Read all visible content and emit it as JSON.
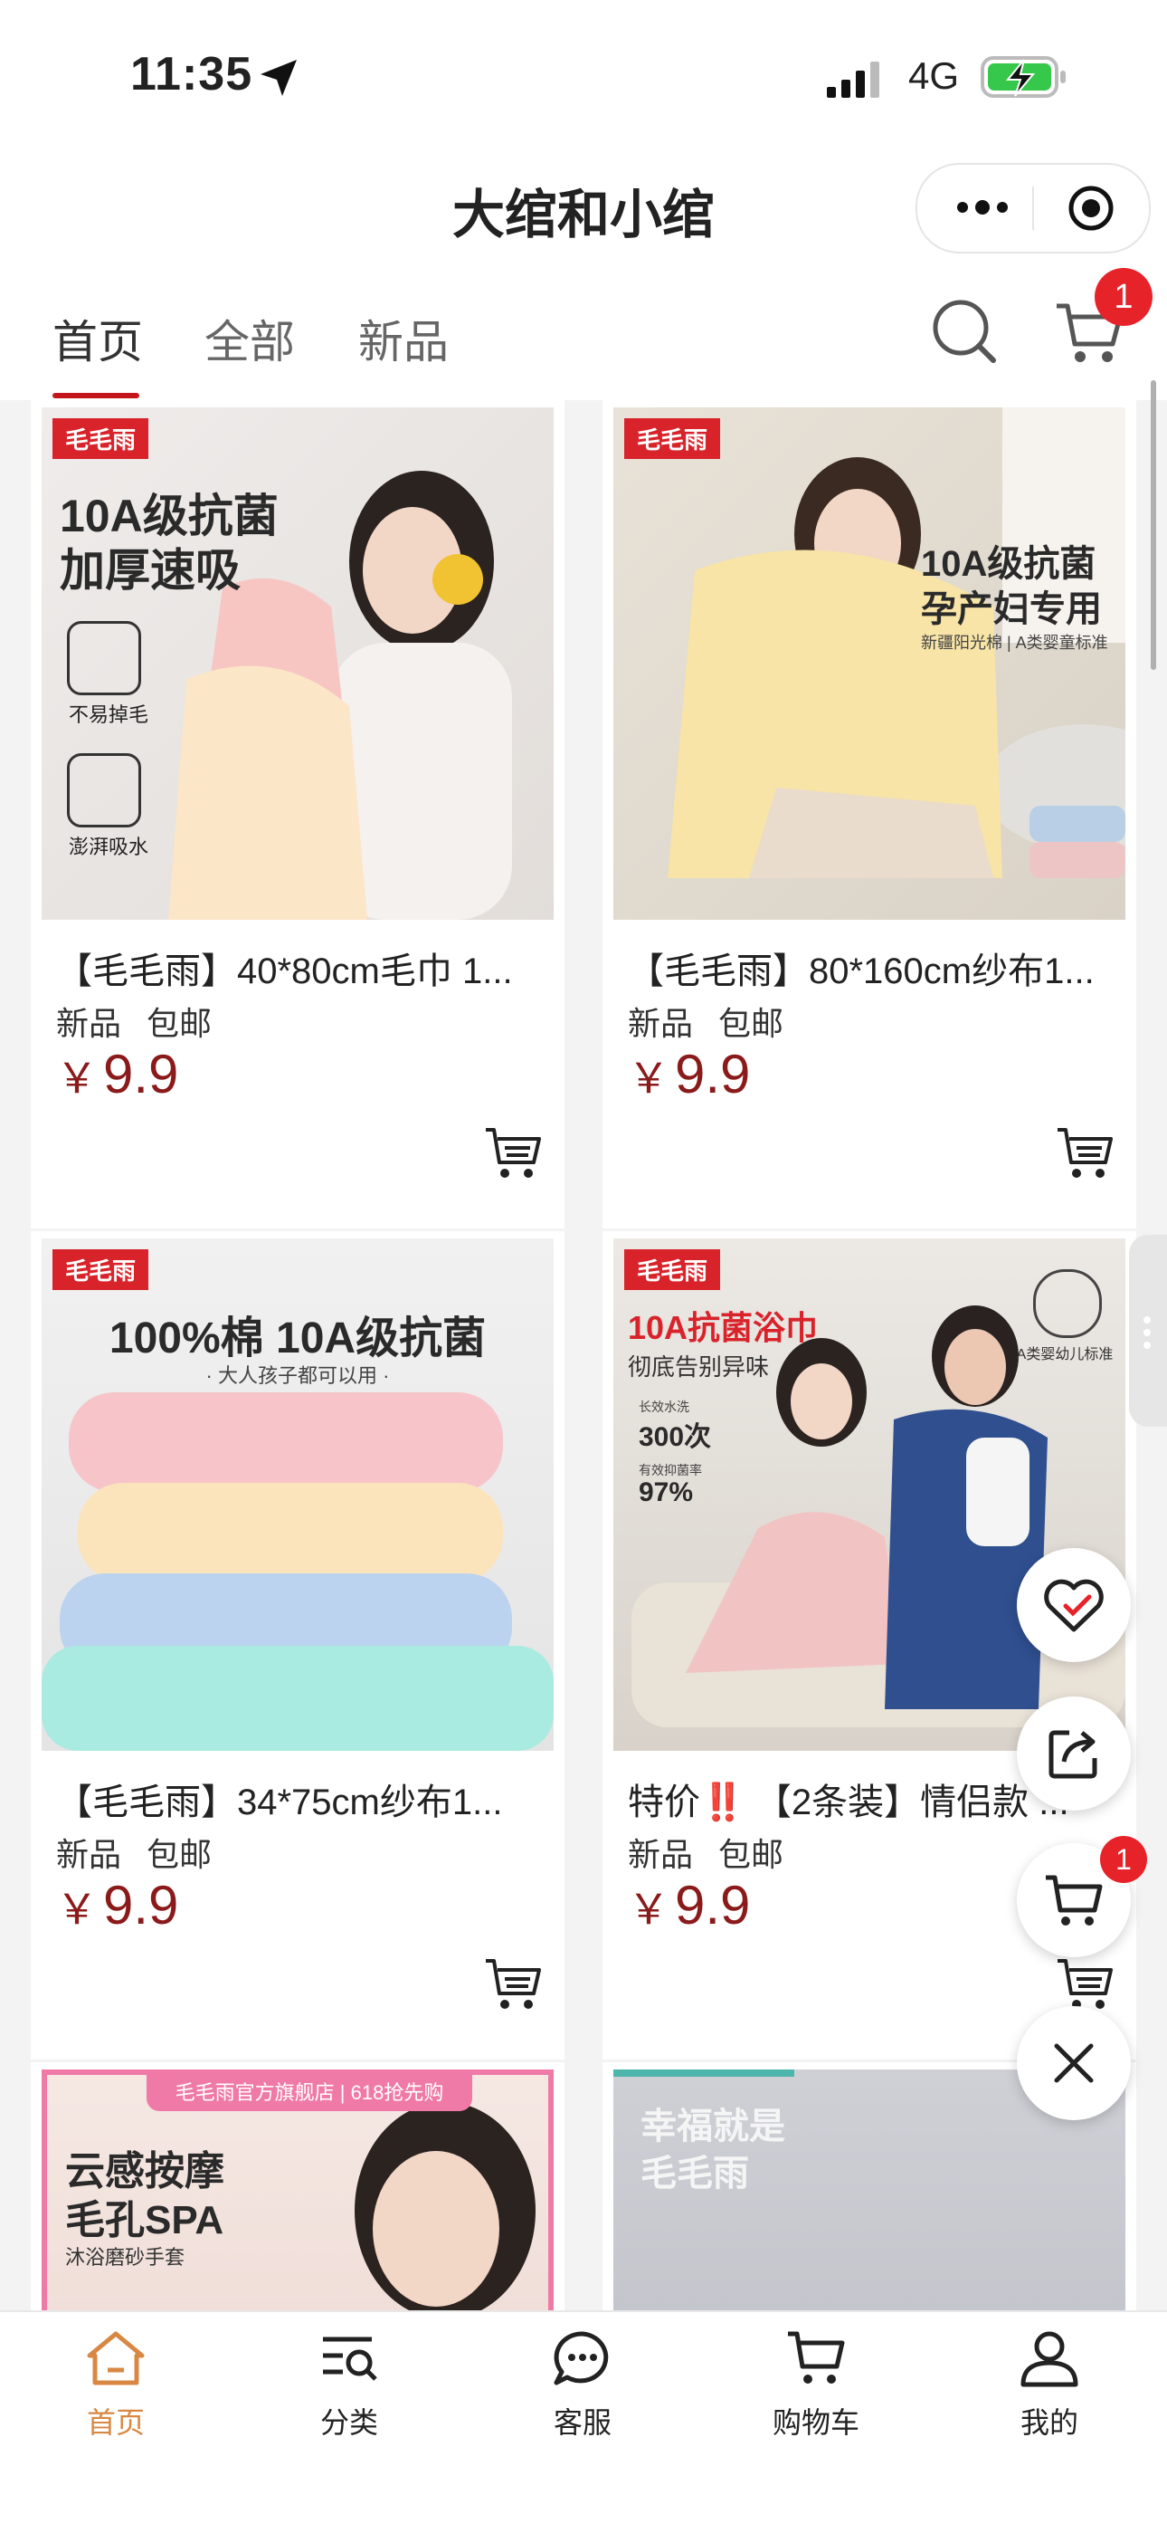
{
  "status_bar": {
    "time": "11:35",
    "network": "4G"
  },
  "title_bar": {
    "title": "大绾和小绾"
  },
  "tabs": [
    {
      "label": "首页",
      "active": true
    },
    {
      "label": "全部",
      "active": false
    },
    {
      "label": "新品",
      "active": false
    }
  ],
  "cart_count": "1",
  "products": [
    {
      "title": "【毛毛雨】40*80cm毛巾 1...",
      "tags": [
        "新品",
        "包邮"
      ],
      "price_symbol": "￥",
      "price": "9.9",
      "image": {
        "brand": "毛毛雨",
        "headline_1": "10A级抗菌",
        "headline_2": "加厚速吸",
        "feature_1": "不易掉毛",
        "feature_2": "澎湃吸水"
      }
    },
    {
      "title": "【毛毛雨】80*160cm纱布1...",
      "tags": [
        "新品",
        "包邮"
      ],
      "price_symbol": "￥",
      "price": "9.9",
      "image": {
        "brand": "毛毛雨",
        "headline_1": "10A级抗菌",
        "headline_2": "孕产妇专用",
        "sub": "新疆阳光棉 | A类婴童标准"
      }
    },
    {
      "title": "【毛毛雨】34*75cm纱布1...",
      "tags": [
        "新品",
        "包邮"
      ],
      "price_symbol": "￥",
      "price": "9.9",
      "image": {
        "brand": "毛毛雨",
        "headline_1": "100%棉 10A级抗菌",
        "sub": "· 大人孩子都可以用 ·"
      }
    },
    {
      "title": "特价‼️ 【2条装】情侣款 ...",
      "tags": [
        "新品",
        "包邮"
      ],
      "price_symbol": "￥",
      "price": "9.9",
      "image": {
        "brand": "毛毛雨",
        "headline_1": "10A抗菌浴巾",
        "headline_2": "彻底告别异味",
        "stat_1_label": "长效水洗",
        "stat_1": "300次",
        "stat_2_label": "有效抑菌率",
        "stat_2": "97%",
        "badge": "A类婴幼儿标准"
      }
    },
    {
      "image": {
        "banner": "毛毛雨官方旗舰店 | 618抢先购",
        "headline_1": "云感按摩",
        "headline_2": "毛孔SPA",
        "sub": "沐浴磨砂手套"
      }
    },
    {
      "image": {
        "headline_1": "幸福就是",
        "headline_2": "毛毛雨"
      }
    }
  ],
  "float_cart_count": "1",
  "bottom_nav": [
    {
      "label": "首页",
      "icon": "home-icon",
      "active": true
    },
    {
      "label": "分类",
      "icon": "category-icon",
      "active": false
    },
    {
      "label": "客服",
      "icon": "chat-icon",
      "active": false
    },
    {
      "label": "购物车",
      "icon": "cart-icon",
      "active": false
    },
    {
      "label": "我的",
      "icon": "user-icon",
      "active": false
    }
  ],
  "colors": {
    "accent": "#c4151c",
    "price": "#8b1a1a",
    "nav_active": "#d88842",
    "badge": "#e7232a"
  }
}
